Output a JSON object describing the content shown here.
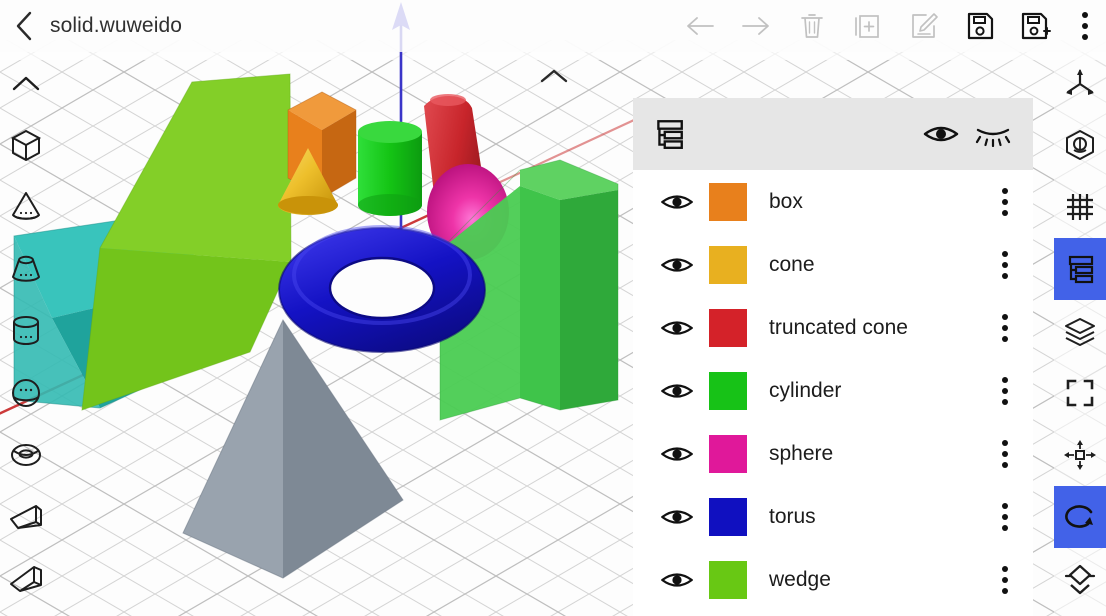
{
  "header": {
    "back_icon": "chevron-left-icon",
    "title": "solid.wuweido",
    "tools": [
      {
        "name": "undo-button",
        "icon": "arrow-left-icon",
        "enabled": false
      },
      {
        "name": "redo-button",
        "icon": "arrow-right-icon",
        "enabled": false
      },
      {
        "name": "delete-button",
        "icon": "trash-icon",
        "enabled": false
      },
      {
        "name": "duplicate-button",
        "icon": "add-frame-icon",
        "enabled": false
      },
      {
        "name": "edit-button",
        "icon": "edit-pencil-icon",
        "enabled": false
      },
      {
        "name": "save-button",
        "icon": "save-icon",
        "enabled": true
      },
      {
        "name": "save-as-button",
        "icon": "save-as-icon",
        "enabled": true
      }
    ],
    "overflow_icon": "kebab-menu-icon"
  },
  "left_rail": {
    "items": [
      {
        "name": "collapse-toolbar-button",
        "icon": "chevron-up-icon"
      },
      {
        "name": "add-box-button",
        "icon": "box-icon"
      },
      {
        "name": "add-cone-button",
        "icon": "cone-icon"
      },
      {
        "name": "add-truncated-cone-button",
        "icon": "truncated-cone-icon"
      },
      {
        "name": "add-cylinder-button",
        "icon": "cylinder-icon"
      },
      {
        "name": "add-sphere-button",
        "icon": "sphere-icon"
      },
      {
        "name": "add-torus-button",
        "icon": "torus-icon"
      },
      {
        "name": "add-wedge-button",
        "icon": "wedge-icon"
      },
      {
        "name": "add-prism-button",
        "icon": "prism-icon"
      }
    ]
  },
  "right_rail": {
    "active_color": "#4262E8",
    "items": [
      {
        "name": "axes-button",
        "icon": "axes-icon",
        "active": false
      },
      {
        "name": "view-cube-button",
        "icon": "view-cube-icon",
        "active": false
      },
      {
        "name": "grid-button",
        "icon": "grid-icon",
        "active": false
      },
      {
        "name": "object-tree-button",
        "icon": "tree-list-icon",
        "active": true
      },
      {
        "name": "layers-button",
        "icon": "layers-icon",
        "active": false
      },
      {
        "name": "fit-view-button",
        "icon": "fit-frame-icon",
        "active": false
      },
      {
        "name": "move-button",
        "icon": "move-arrows-icon",
        "active": false
      },
      {
        "name": "rotate-button",
        "icon": "rotate-icon",
        "active": true
      },
      {
        "name": "flip-button",
        "icon": "flip-icon",
        "active": false
      }
    ]
  },
  "scene": {
    "collapse_icon": "chevron-up-icon",
    "axis_z_color": "#3A35C8",
    "axis_x_color": "#C82A2A",
    "grid_color": "#c9c9c9",
    "background": "#fcfcfc",
    "objects": [
      {
        "name": "wedge-green",
        "color": "#7CC81E"
      },
      {
        "name": "wedge-teal",
        "color": "#2BB5AC"
      },
      {
        "name": "box-orange",
        "color": "#E8801C"
      },
      {
        "name": "cone-gold",
        "color": "#E8B020"
      },
      {
        "name": "cylinder-green",
        "color": "#17C217"
      },
      {
        "name": "truncated-cone-red",
        "color": "#C8252B"
      },
      {
        "name": "sphere-magenta",
        "color": "#E0189A"
      },
      {
        "name": "torus-blue",
        "color": "#1010C0"
      },
      {
        "name": "prism-green",
        "color": "#3FC44A"
      },
      {
        "name": "pyramid-gray",
        "color": "#8D97A3"
      }
    ]
  },
  "panel": {
    "header": {
      "tree_icon": "tree-list-icon",
      "show_all": {
        "name": "show-all-button",
        "icon": "eye-icon"
      },
      "hide_all": {
        "name": "hide-all-button",
        "icon": "eye-closed-icon"
      }
    },
    "items": [
      {
        "label": "box",
        "color": "#E8801C",
        "visible": true
      },
      {
        "label": "cone",
        "color": "#E8B020",
        "visible": true
      },
      {
        "label": "truncated cone",
        "color": "#D42229",
        "visible": true
      },
      {
        "label": "cylinder",
        "color": "#17C217",
        "visible": true
      },
      {
        "label": "sphere",
        "color": "#E0189A",
        "visible": true
      },
      {
        "label": "torus",
        "color": "#1010C0",
        "visible": true
      },
      {
        "label": "wedge",
        "color": "#68C814",
        "visible": true
      }
    ]
  }
}
